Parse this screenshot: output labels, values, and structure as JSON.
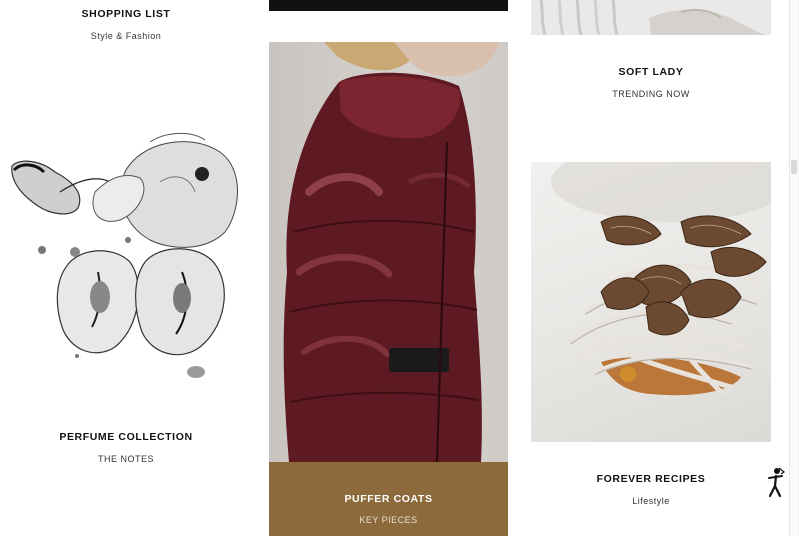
{
  "cards": {
    "shopping_list": {
      "title": "SHOPPING LIST",
      "subtitle": "Style & Fashion"
    },
    "perfume": {
      "title": "PERFUME COLLECTION",
      "subtitle": "THE NOTES",
      "image": "floral-watercolor-illustration"
    },
    "puffer": {
      "title": "PUFFER COATS",
      "subtitle": "KEY PIECES",
      "image": "burgundy-puffer-coat-photo",
      "caption_bg": "#8c6a3b"
    },
    "soft_lady": {
      "title": "SOFT LADY",
      "subtitle": "TRENDING NOW",
      "image": "white-knit-sweater-photo"
    },
    "forever_recipes": {
      "title": "FOREVER RECIPES",
      "subtitle": "Lifestyle",
      "image": "truffle-noodle-dish-photo"
    }
  },
  "icons": {
    "accessibility": "accessibility-person-icon"
  },
  "colors": {
    "accent_brown": "#8c6a3b",
    "coat_burgundy": "#5e1a22",
    "text": "#111111"
  }
}
